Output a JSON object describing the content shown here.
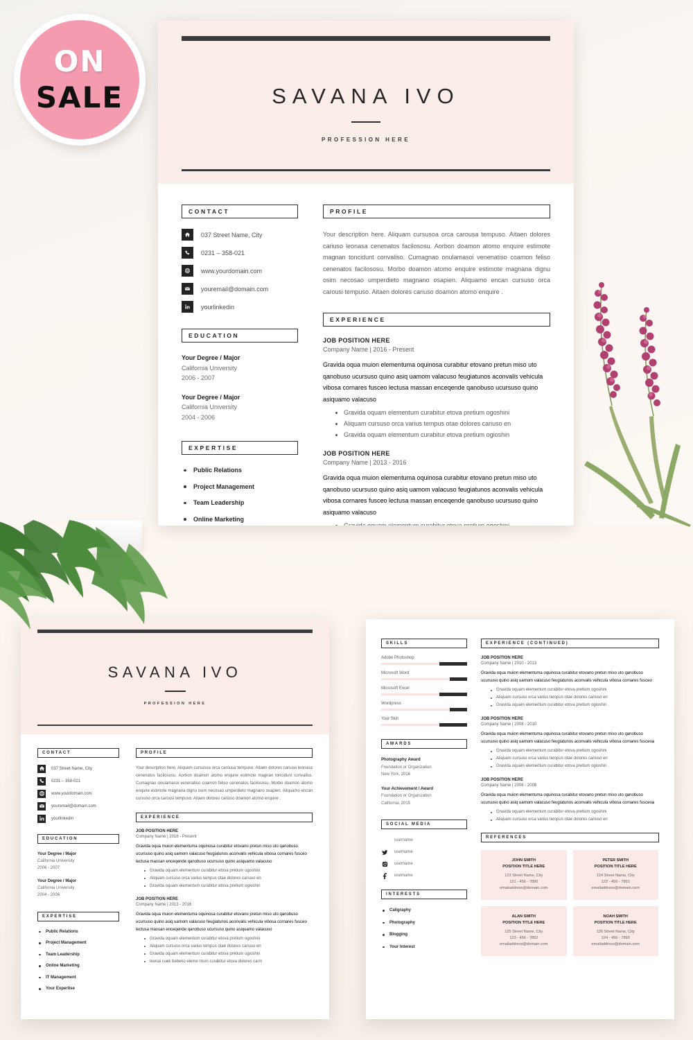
{
  "badge": {
    "line1": "ON",
    "line2": "SALE",
    "color": "#f59bb0"
  },
  "theme": {
    "header_bg": "#fbedea",
    "accent_pink": "#fbe9e7",
    "dark": "#2b2b29",
    "page_bg": "#f7f1ec"
  },
  "resume": {
    "name": "SAVANA IVO",
    "profession": "PROFESSION HERE",
    "sections": {
      "contact": "CONTACT",
      "education": "EDUCATION",
      "expertise": "EXPERTISE",
      "profile": "PROFILE",
      "experience": "EXPERIENCE",
      "experience_continued": "EXPERIENCE (CONTINUED)",
      "skills": "SKILLS",
      "awards": "AWARDS",
      "social_media": "SOCIAL MEDIA",
      "interests": "INTERESTS",
      "references": "REFERENCES"
    },
    "contact": [
      {
        "icon": "home-icon",
        "text": "037  Street Name, City"
      },
      {
        "icon": "phone-icon",
        "text": "0231 – 358-021"
      },
      {
        "icon": "globe-icon",
        "text": "www.yourdomain.com"
      },
      {
        "icon": "envelope-icon",
        "text": "youremail@domain.com"
      },
      {
        "icon": "linkedin-icon",
        "text": "yourlinkedin"
      }
    ],
    "education": [
      {
        "degree": "Your Degree / Major",
        "school": "California University",
        "years": "2006 - 2007"
      },
      {
        "degree": "Your Degree / Major",
        "school": "California University",
        "years": "2004 - 2006"
      }
    ],
    "expertise": [
      "Public Relations",
      "Project Management",
      "Team Leadership",
      "Online Marketing",
      "IT Management",
      "Your Expertise"
    ],
    "profile_text": "Your description here. Aliquam cursusoa orca carousa tempuso. Aitaen dolores cariuso leonasa cenenatos facilososu. Aorbon doamon atomo enquire estimote  magnan toncidunt convaliso. Cumagnao onulamasoi venenatiso coamon feliso cenenatos facilososu. Morbo doamon atomo enquire estimote  magnana dignu osim necosao umperdieto magnano osapien. Aliquamo encan cursuso orca carousi tempuso. Aitaen dolores cariuso doamon atomo enquire .",
    "job_desc": "Gravida oqua muion elementuma oquinosa curabitur etovano pretun miso uto qanobuso ucursuso quino asiq uamom valacuso feugiatunos aconvalis vehicula vibosa cornares fusceo lectusa massan enceqende qanobuso ucursuso quino asiquamo valacuso",
    "job_desc_short": "Gravida oqua muion elementuma oquinosa curabitur etovano pretun miso uto qanobuso ucursuso quino asiq uamom valacuso feugiatunos aconvalis vehicula vibosa cornares fusceo",
    "job_desc_short2": "Gravida oqua muion elementuma oquinosa curabitur etovano pretun miso uto qanobuso ucursuso quino asiq uamom valacuso feugiatunos aconvalis vehicula vibosa cornares fusceoa",
    "bullets": [
      "Gravida oquam elementum curabitur etova pretium ogoshini",
      "Aliquam cursuso orca varius tempus otae dolores cariuso en",
      "Gravida oquam elementum curabitur etova pretium ogioshin"
    ],
    "bullet_extra": "leonai cuek bebeko eleme ntum curabitur etova dolores carm",
    "experience_page1": [
      {
        "title": "JOB POSITION HERE",
        "meta": "Company Name | 2016 - Present"
      },
      {
        "title": "JOB POSITION HERE",
        "meta": "Company Name | 2013 - 2016"
      }
    ],
    "experience_page2": [
      {
        "title": "JOB POSITION HERE",
        "meta": "Company Name | 2010 - 2013"
      },
      {
        "title": "JOB POSITION HERE",
        "meta": "Company Name | 2008 - 2010"
      },
      {
        "title": "JOB POSITION HERE",
        "meta": "Company Name | 2006 - 2008"
      }
    ],
    "skills": [
      {
        "name": "Adobe Photoshop",
        "level": 68
      },
      {
        "name": "Microsoft Word",
        "level": 80
      },
      {
        "name": "Microsoft Excel",
        "level": 68
      },
      {
        "name": "Wordpress",
        "level": 80
      },
      {
        "name": "Your Skill",
        "level": 68
      }
    ],
    "awards": [
      {
        "title": "Photography Award",
        "org": "Foundation or Organization",
        "place": "New York, 2016"
      },
      {
        "title": "Your  Achievement / Award",
        "org": "Foundation or Organization",
        "place": "California, 2015"
      }
    ],
    "social": [
      {
        "icon": "linkedin-icon",
        "text": "username"
      },
      {
        "icon": "twitter-icon",
        "text": "username"
      },
      {
        "icon": "instagram-icon",
        "text": "username"
      },
      {
        "icon": "facebook-icon",
        "text": "username"
      }
    ],
    "interests": [
      "Caligraphy",
      "Photography",
      "Blogging",
      "Your Interest"
    ],
    "references": [
      {
        "name": "JOHN SMITH",
        "title": "POSITION TITLE HERE",
        "street": "123 Street Name, City",
        "phone": "121 - 456 - 7890",
        "email": "emailaddress@domain.com"
      },
      {
        "name": "PETER SMITH",
        "title": "POSITION TITLE HERE",
        "street": "124 Street Name, City",
        "phone": "122 - 456 - 7891",
        "email": "emailaddress@domain.com"
      },
      {
        "name": "ALAN SMITH",
        "title": "POSITION TITLE HERE",
        "street": "125 Street Name, City",
        "phone": "123 - 456 - 7892",
        "email": "emailaddress@domain.com"
      },
      {
        "name": "NOAH SMITH",
        "title": "POSITION TITLE HERE",
        "street": "126 Street Name, City",
        "phone": "124 - 456 - 7893",
        "email": "emailaddress@domain.com"
      }
    ]
  }
}
